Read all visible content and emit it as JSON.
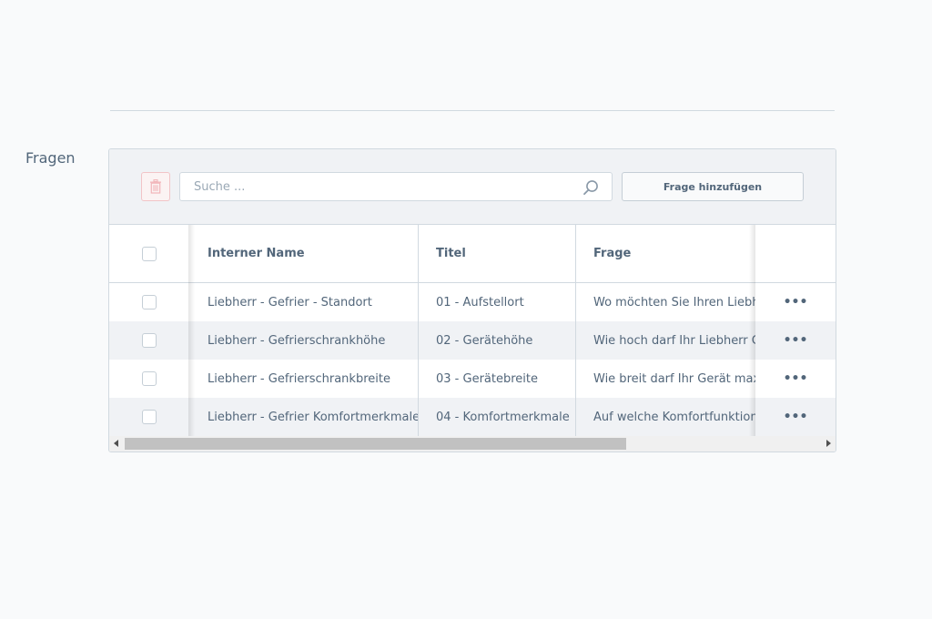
{
  "section": {
    "label": "Fragen"
  },
  "toolbar": {
    "search_placeholder": "Suche ...",
    "add_button_label": "Frage hinzufügen",
    "delete_icon": "trash-icon",
    "search_icon": "magnifier-icon"
  },
  "table": {
    "columns": {
      "name": "Interner Name",
      "title": "Titel",
      "question": "Frage"
    },
    "rows": [
      {
        "name": "Liebherr - Gefrier - Standort",
        "title": "01 - Aufstellort",
        "question": "Wo möchten Sie Ihren Liebherr"
      },
      {
        "name": "Liebherr - Gefrierschrankhöhe",
        "title": "02 - Gerätehöhe",
        "question": "Wie hoch darf Ihr Liebherr Gefr"
      },
      {
        "name": "Liebherr - Gefrierschrankbreite",
        "title": "03 - Gerätebreite",
        "question": "Wie breit darf Ihr Gerät maxima"
      },
      {
        "name": "Liebherr - Gefrier Komfortmerkmale",
        "title": "04 - Komfortmerkmale",
        "question": "Auf welche Komfortfunktionen"
      }
    ],
    "row_action_label": "•••"
  },
  "scrollbar": {
    "horizontal_position": 0.0
  },
  "colors": {
    "background": "#f9fafb",
    "toolbar": "#f0f2f5",
    "text": "#52667a",
    "border": "#d1d9e0",
    "delete_accent": "#f2c4c7"
  }
}
